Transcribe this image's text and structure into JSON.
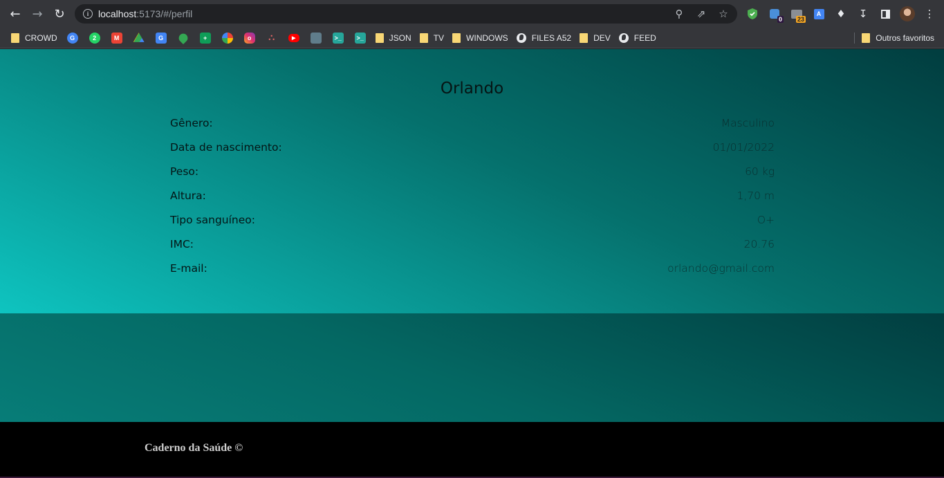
{
  "browser": {
    "url_host": "localhost",
    "url_rest": ":5173/#/perfil",
    "extension_badges": {
      "ext1": "0",
      "ext2": "23"
    },
    "bookmarks": [
      {
        "type": "folder",
        "label": "CROWD"
      },
      {
        "type": "icon",
        "icon": "google-icon"
      },
      {
        "type": "icon",
        "icon": "whatsapp-icon"
      },
      {
        "type": "icon",
        "icon": "gmail-icon"
      },
      {
        "type": "icon",
        "icon": "drive-icon"
      },
      {
        "type": "icon",
        "icon": "translate-icon"
      },
      {
        "type": "icon",
        "icon": "maps-icon"
      },
      {
        "type": "icon",
        "icon": "sheets-icon"
      },
      {
        "type": "icon",
        "icon": "pinwheel-icon"
      },
      {
        "type": "icon",
        "icon": "instagram-icon"
      },
      {
        "type": "icon",
        "icon": "asana-icon"
      },
      {
        "type": "icon",
        "icon": "youtube-icon"
      },
      {
        "type": "icon",
        "icon": "app-icon"
      },
      {
        "type": "icon",
        "icon": "terminal-icon"
      },
      {
        "type": "icon",
        "icon": "terminal-icon"
      },
      {
        "type": "folder",
        "label": "JSON"
      },
      {
        "type": "folder",
        "label": "TV"
      },
      {
        "type": "folder",
        "label": "WINDOWS"
      },
      {
        "type": "globe",
        "label": "FILES A52"
      },
      {
        "type": "folder",
        "label": "DEV"
      },
      {
        "type": "globe",
        "label": "FEED"
      }
    ],
    "other_bookmarks": "Outros favoritos"
  },
  "profile": {
    "name": "Orlando",
    "fields": [
      {
        "label": "Gênero:",
        "value": "Masculino"
      },
      {
        "label": "Data de nascimento:",
        "value": "01/01/2022"
      },
      {
        "label": "Peso:",
        "value": "60 kg"
      },
      {
        "label": "Altura:",
        "value": "1,70 m"
      },
      {
        "label": "Tipo sanguíneo:",
        "value": "O+"
      },
      {
        "label": "IMC:",
        "value": "20.76"
      },
      {
        "label": "E-mail:",
        "value": "orlando@gmail.com"
      }
    ]
  },
  "footer": {
    "text": "Caderno da Saúde ©"
  },
  "colors": {
    "hero_dark": "#013d3f",
    "hero_light": "#0ec4c0",
    "footer_bg": "#000000"
  }
}
